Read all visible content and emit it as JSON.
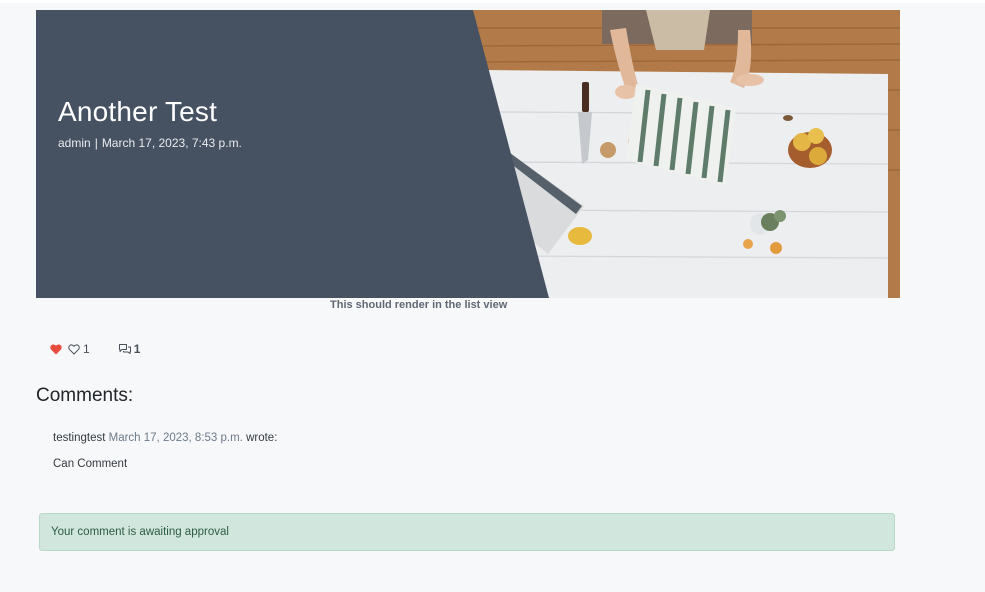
{
  "post": {
    "title": "Another Test",
    "author": "admin",
    "separator": "|",
    "date": "March 17, 2023, 7:43 p.m.",
    "excerpt": "This should render in the list view"
  },
  "stats": {
    "likes_count": "1",
    "comments_count": "1"
  },
  "comments": {
    "heading": "Comments:",
    "items": [
      {
        "author": "testingtest",
        "date": "March 17, 2023, 8:53 p.m.",
        "suffix": "wrote:",
        "body": "Can Comment"
      }
    ]
  },
  "alert": {
    "message": "Your comment is awaiting approval"
  },
  "colors": {
    "hero_panel": "#465162",
    "heart": "#e74c3c",
    "alert_bg": "#d1e7dd"
  },
  "icons": [
    "heart-filled-icon",
    "heart-outline-icon",
    "comment-icon"
  ]
}
